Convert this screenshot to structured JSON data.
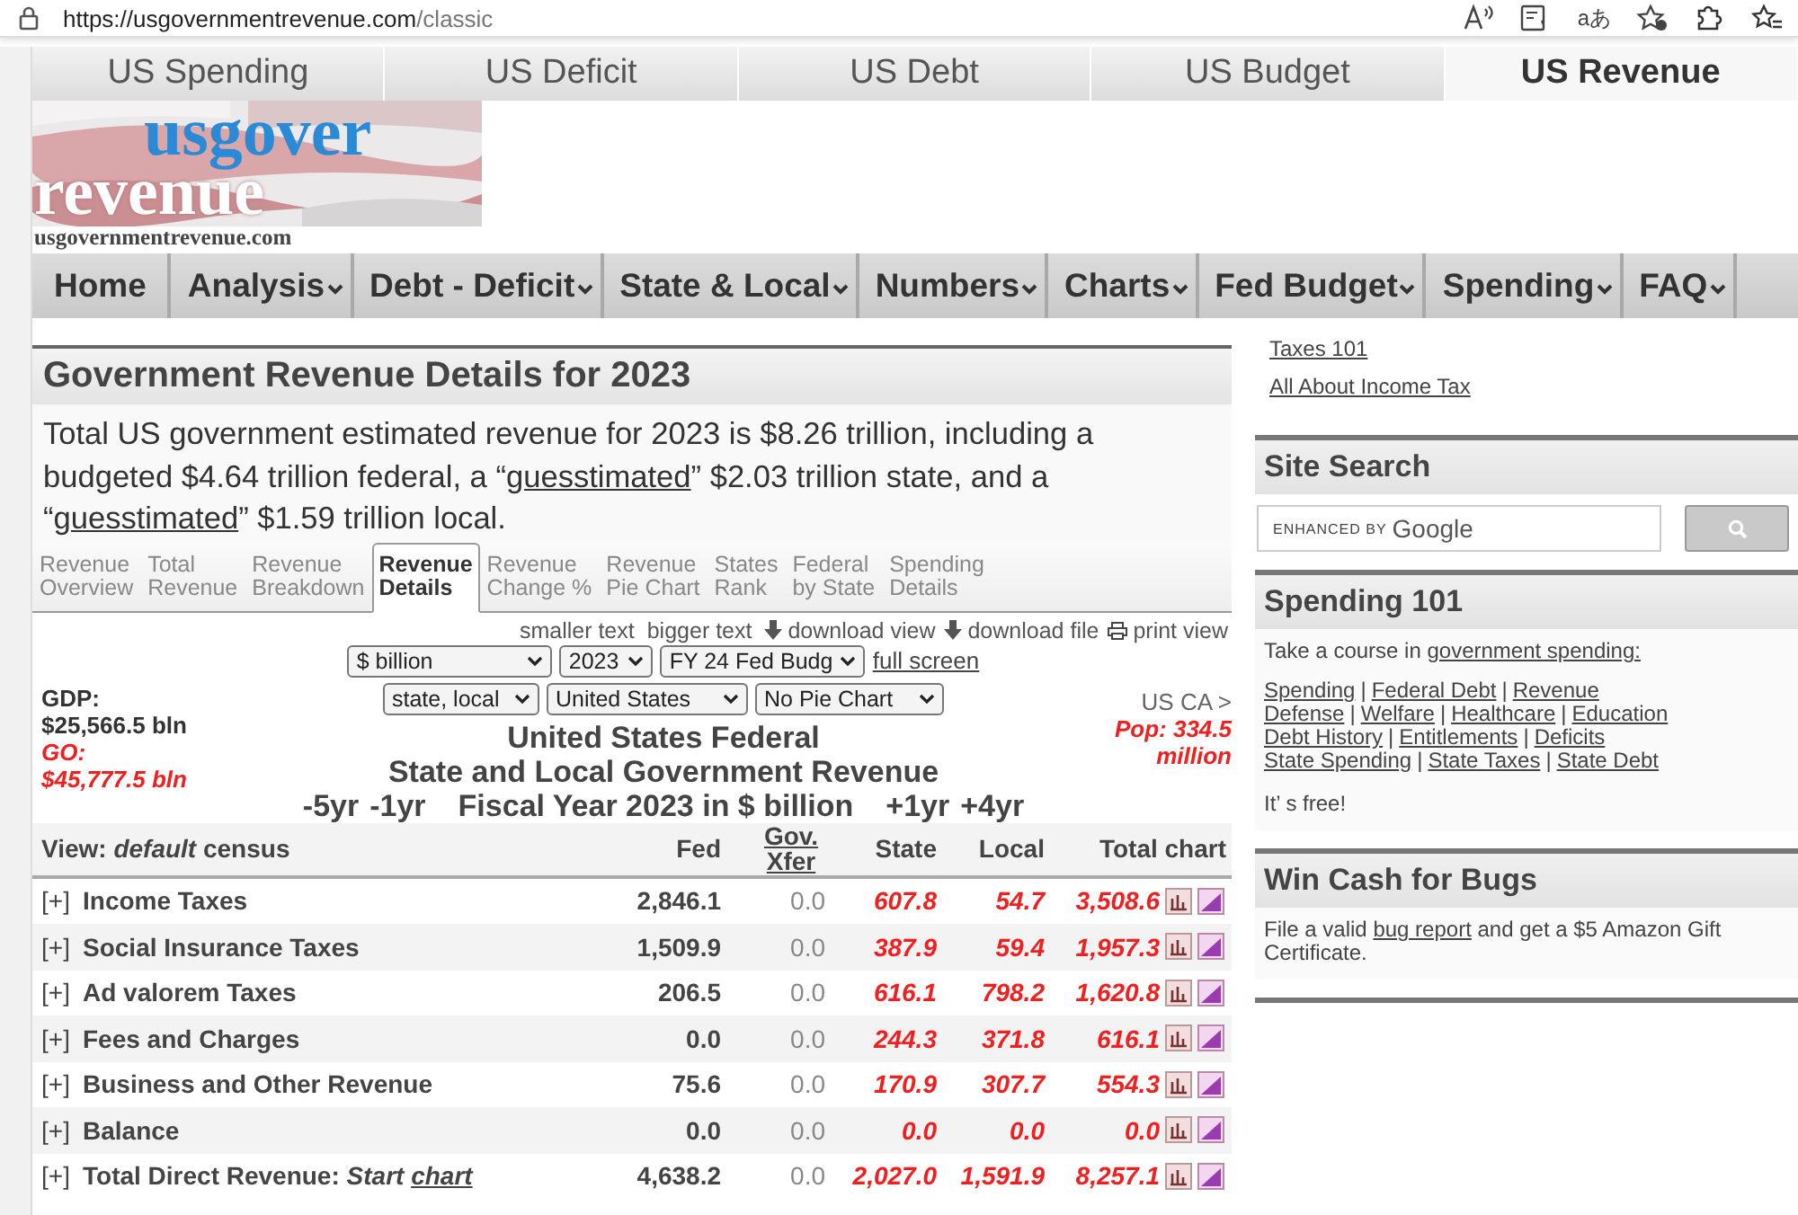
{
  "browser": {
    "url_host": "https://usgovernmentrevenue.com",
    "url_path": "/classic",
    "translate_glyph": "aあ"
  },
  "site_tabs": [
    {
      "label": "US Spending",
      "selected": false
    },
    {
      "label": "US Deficit",
      "selected": false
    },
    {
      "label": "US Debt",
      "selected": false
    },
    {
      "label": "US Budget",
      "selected": false
    },
    {
      "label": "US Revenue",
      "selected": true
    }
  ],
  "logo": {
    "line_1": "usgover",
    "line_2": "revenue",
    "domain": "usgovernmentrevenue.com"
  },
  "nav": [
    {
      "label": "Home",
      "has_menu": false
    },
    {
      "label": "Analysis",
      "has_menu": true
    },
    {
      "label": "Debt - Deficit",
      "has_menu": true
    },
    {
      "label": "State & Local",
      "has_menu": true
    },
    {
      "label": "Numbers",
      "has_menu": true
    },
    {
      "label": "Charts",
      "has_menu": true
    },
    {
      "label": "Fed Budget",
      "has_menu": true
    },
    {
      "label": "Spending",
      "has_menu": true
    },
    {
      "label": "FAQ",
      "has_menu": true
    }
  ],
  "main": {
    "title": "Government Revenue Details for 2023",
    "intro": [
      {
        "kind": "text",
        "text": "Total US government estimated revenue for 2023 is $8.26 trillion, including a budgeted $4.64 trillion federal, a  “"
      },
      {
        "kind": "link",
        "text": "guesstimated"
      },
      {
        "kind": "text",
        "text": "”  $2.03 trillion state, and a “"
      },
      {
        "kind": "link",
        "text": "guesstimated"
      },
      {
        "kind": "text",
        "text": "”  $1.59 trillion local."
      }
    ],
    "sub_tabs": [
      {
        "lines": [
          "Revenue",
          "Overview"
        ],
        "selected": false
      },
      {
        "lines": [
          "Total",
          "Revenue"
        ],
        "selected": false
      },
      {
        "lines": [
          "Revenue",
          "Breakdown"
        ],
        "selected": false
      },
      {
        "lines": [
          "Revenue",
          "Details"
        ],
        "selected": true
      },
      {
        "lines": [
          "Revenue",
          "Change %"
        ],
        "selected": false
      },
      {
        "lines": [
          "Revenue",
          "Pie Chart"
        ],
        "selected": false
      },
      {
        "lines": [
          "States",
          "Rank"
        ],
        "selected": false
      },
      {
        "lines": [
          "Federal",
          "by State"
        ],
        "selected": false
      },
      {
        "lines": [
          "Spending",
          "Details"
        ],
        "selected": false
      }
    ],
    "tools": [
      {
        "label": "smaller text",
        "kind": "plain"
      },
      {
        "label": "bigger text",
        "kind": "plain"
      },
      {
        "label": "download view",
        "kind": "download"
      },
      {
        "label": "download file",
        "kind": "download"
      },
      {
        "label": "print view",
        "kind": "print"
      }
    ],
    "selects_row_1": [
      "$ billion",
      "2023",
      "FY 24 Fed Budg"
    ],
    "full_screen_link": "full screen",
    "selects_row_2": [
      "state, local",
      "United States",
      "No Pie Chart"
    ],
    "gdp": {
      "label": "GDP:",
      "value": "$25,566.5 bln",
      "go_label": "GO:",
      "go_value": "$45,777.5 bln"
    },
    "region": {
      "link": "US CA >",
      "population": "Pop: 334.5 million"
    },
    "title_lines": [
      "United States Federal",
      "State and Local Government Revenue"
    ],
    "year_nav": {
      "back_5": "-5yr",
      "back_1": "-1yr",
      "label": "Fiscal Year 2023 in $ billion",
      "fwd_1": "+1yr",
      "fwd_4": "+4yr"
    },
    "table": {
      "view_label": "View: *default* census",
      "columns": [
        {
          "label": "Fed",
          "kind": "plain"
        },
        {
          "label": "Gov. Xfer",
          "kind": "link"
        },
        {
          "label": "State",
          "kind": "plain"
        },
        {
          "label": "Local",
          "kind": "plain"
        },
        {
          "label": "Total chart",
          "kind": "plain"
        }
      ],
      "rows": [
        {
          "kind": "item",
          "expander": "[+]",
          "label": "Income Taxes",
          "fed": "2,846.1",
          "xfer": "0.0",
          "state": "607.8",
          "local": "54.7",
          "total": "3,508.6",
          "estimated": true
        },
        {
          "kind": "item",
          "expander": "[+]",
          "label": "Social Insurance Taxes",
          "fed": "1,509.9",
          "xfer": "0.0",
          "state": "387.9",
          "local": "59.4",
          "total": "1,957.3",
          "estimated": true
        },
        {
          "kind": "item",
          "expander": "[+]",
          "label": "Ad valorem Taxes",
          "fed": "206.5",
          "xfer": "0.0",
          "state": "616.1",
          "local": "798.2",
          "total": "1,620.8",
          "estimated": true
        },
        {
          "kind": "item",
          "expander": "[+]",
          "label": "Fees and Charges",
          "fed": "0.0",
          "xfer": "0.0",
          "state": "244.3",
          "local": "371.8",
          "total": "616.1",
          "estimated": true
        },
        {
          "kind": "item",
          "expander": "[+]",
          "label": "Business and Other Revenue",
          "fed": "75.6",
          "xfer": "0.0",
          "state": "170.9",
          "local": "307.7",
          "total": "554.3",
          "estimated": true
        },
        {
          "kind": "item",
          "expander": "[+]",
          "label": "Balance",
          "fed": "0.0",
          "xfer": "0.0",
          "state": "0.0",
          "local": "0.0",
          "total": "0.0",
          "estimated": true
        },
        {
          "kind": "total",
          "expander": "[+]",
          "label": "Total Direct Revenue:",
          "start_text": "Start",
          "chart_link": "chart",
          "fed": "4,638.2",
          "xfer": "0.0",
          "state": "2,027.0",
          "local": "1,591.9",
          "total": "8,257.1",
          "estimated": true
        }
      ]
    }
  },
  "sidebar": {
    "top_links": [
      "Taxes 101",
      "All About Income Tax"
    ],
    "site_search": {
      "title": "Site Search",
      "placeholder_prefix": "ENHANCED BY",
      "placeholder_brand": "Google"
    },
    "spending_101": {
      "title": "Spending 101",
      "intro": "Take a course in ",
      "intro_link": "government spending:",
      "separator": "|",
      "link_lines": [
        [
          "Spending",
          "Federal Debt",
          "Revenue"
        ],
        [
          "Defense",
          "Welfare",
          "Healthcare",
          "Education"
        ],
        [
          "Debt History",
          "Entitlements",
          "Deficits"
        ],
        [
          "State Spending",
          "State Taxes",
          "State Debt"
        ]
      ],
      "footer": "It’ s free!"
    },
    "win_cash": {
      "title": "Win Cash for Bugs",
      "before": "File a valid ",
      "link": "bug report",
      "after": " and get a $5 Amazon Gift Certificate."
    }
  }
}
